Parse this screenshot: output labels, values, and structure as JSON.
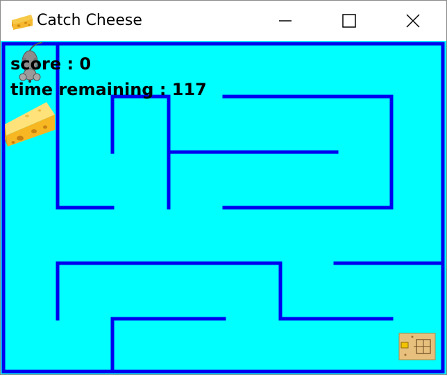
{
  "window": {
    "title": "Catch Cheese",
    "app_icon": "cheese-icon",
    "controls": {
      "minimize_icon": "minimize-icon",
      "maximize_icon": "maximize-icon",
      "close_icon": "close-icon"
    }
  },
  "hud": {
    "score_text": "score : 0",
    "time_text": "time remaining : 117",
    "score": 0,
    "time_remaining": 117
  },
  "sprites": {
    "player": "mouse-icon",
    "goal": "cheese-icon",
    "bonus": "treasure-map-icon"
  },
  "colors": {
    "background": "#00FFFF",
    "walls": "#0000EE",
    "text": "#000000",
    "titlebar": "#FFFFFF"
  }
}
